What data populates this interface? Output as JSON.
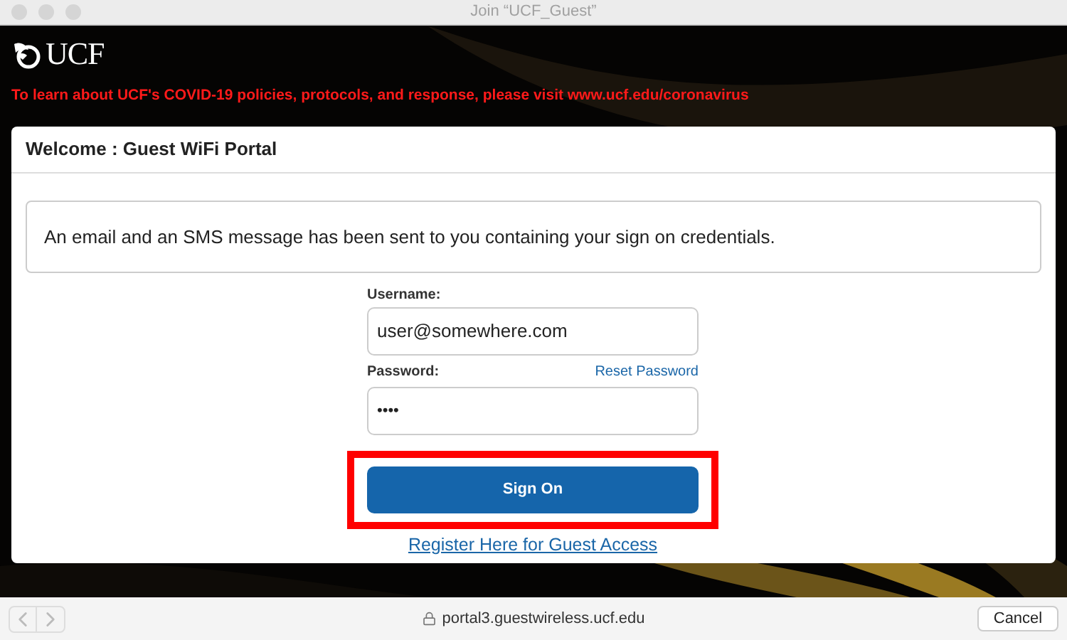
{
  "window": {
    "title": "Join “UCF_Guest”"
  },
  "logo": {
    "text": "UCF"
  },
  "notice": "To learn about UCF's COVID-19 policies, protocols, and response, please visit www.ucf.edu/coronavirus",
  "card": {
    "title": "Welcome : Guest WiFi Portal",
    "message": "An email and an SMS message has been sent to you containing your sign on credentials."
  },
  "form": {
    "username_label": "Username:",
    "username_value": "user@somewhere.com",
    "password_label": "Password:",
    "reset_link": "Reset Password",
    "password_value": "••••",
    "submit": "Sign On",
    "submit_highlighted": true,
    "register_link": "Register Here for Guest Access"
  },
  "bottom_bar": {
    "url": "portal3.guestwireless.ucf.edu",
    "cancel": "Cancel"
  }
}
